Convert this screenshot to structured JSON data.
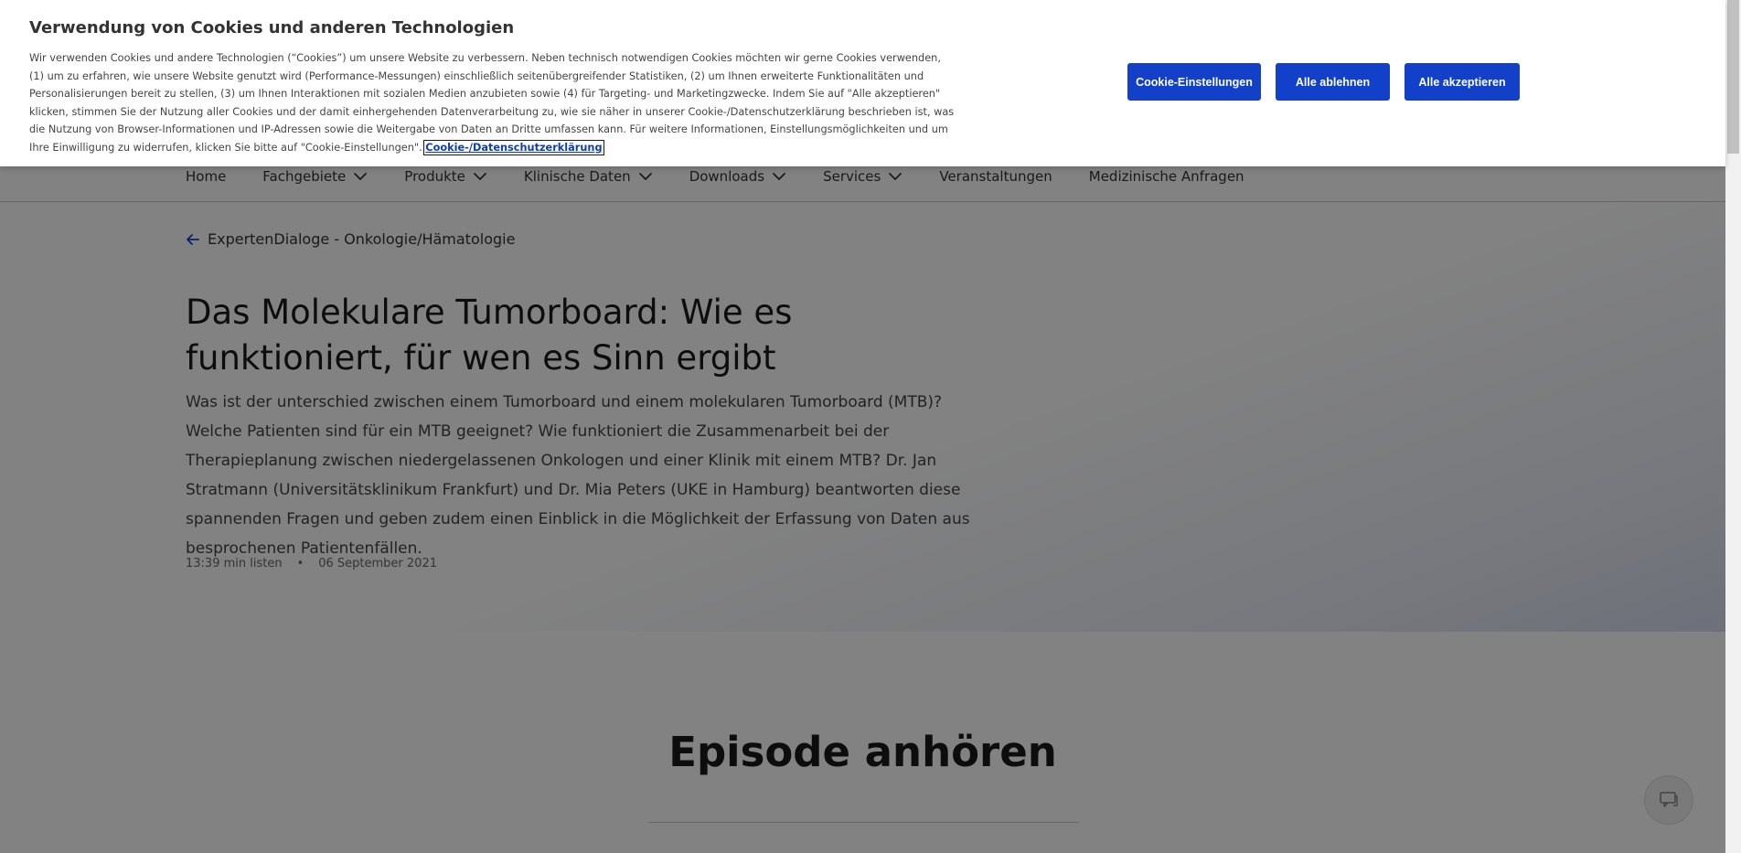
{
  "cookie_banner": {
    "title": "Verwendung von Cookies und anderen Technologien",
    "text": "Wir verwenden Cookies und andere Technologien (“Cookies”) um unsere Website zu verbessern. Neben technisch notwendigen Cookies möchten wir gerne Cookies verwenden, (1) um zu erfahren, wie unsere Website genutzt wird (Performance-Messungen) einschließlich seitenübergreifender Statistiken, (2) um Ihnen erweiterte Funktionalitäten und Personalisierungen bereit zu stellen, (3) um Ihnen Interaktionen mit sozialen Medien anzubieten sowie (4) für Targeting- und Marketingzwecke. Indem Sie auf \"Alle akzeptieren\" klicken, stimmen Sie der Nutzung aller Cookies und der damit einhergehenden Datenverarbeitung zu, wie sie näher in unserer Cookie-/Datenschutzerklärung beschrieben ist, was die Nutzung von Browser-Informationen und IP-Adressen sowie die Weitergabe von Daten an Dritte umfassen kann. Für weitere Informationen, Einstellungsmöglichkeiten und um Ihre Einwilligung zu widerrufen, klicken Sie bitte auf \"Cookie-Einstellungen\".",
    "link_label": "Cookie-/Datenschutzerklärung",
    "buttons": {
      "settings": "Cookie-Einstellungen",
      "reject": "Alle ablehnen",
      "accept": "Alle akzeptieren"
    },
    "button_color": "#1240c8"
  },
  "nav": {
    "items": [
      {
        "label": "Home",
        "dropdown": false
      },
      {
        "label": "Fachgebiete",
        "dropdown": true
      },
      {
        "label": "Produkte",
        "dropdown": true
      },
      {
        "label": "Klinische Daten",
        "dropdown": true
      },
      {
        "label": "Downloads",
        "dropdown": true
      },
      {
        "label": "Services",
        "dropdown": true
      },
      {
        "label": "Veranstaltungen",
        "dropdown": false
      },
      {
        "label": "Medizinische Anfragen",
        "dropdown": false
      }
    ]
  },
  "hero": {
    "back_label": "ExpertenDialoge - Onkologie/Hämatologie",
    "title": "Das Molekulare Tumorboard: Wie es funktioniert, für wen es Sinn ergibt",
    "description": "Was ist der unterschied zwischen einem Tumorboard und einem molekularen Tumorboard (MTB)? Welche Patienten sind für ein MTB geeignet? Wie funktioniert die Zusammenarbeit bei der Therapieplanung zwischen niedergelassenen Onkologen und einer Klinik mit einem MTB? Dr. Jan Stratmann (Universitätsklinikum Frankfurt) und Dr. Mia Peters (UKE in Hamburg) beantworten diese spannenden Fragen und geben zudem einen Einblick in die Möglichkeit der Erfassung von Daten aus besprochenen Patientenfällen.",
    "duration": "13:39 min listen",
    "separator": "•",
    "date": "06 September 2021"
  },
  "episode": {
    "title": "Episode anhören"
  },
  "icons": {
    "back": "arrow-left-icon",
    "chevron": "chevron-down-icon",
    "chat": "chat-icon"
  },
  "colors": {
    "accent": "#1240c8",
    "back_arrow": "#1240c8"
  }
}
